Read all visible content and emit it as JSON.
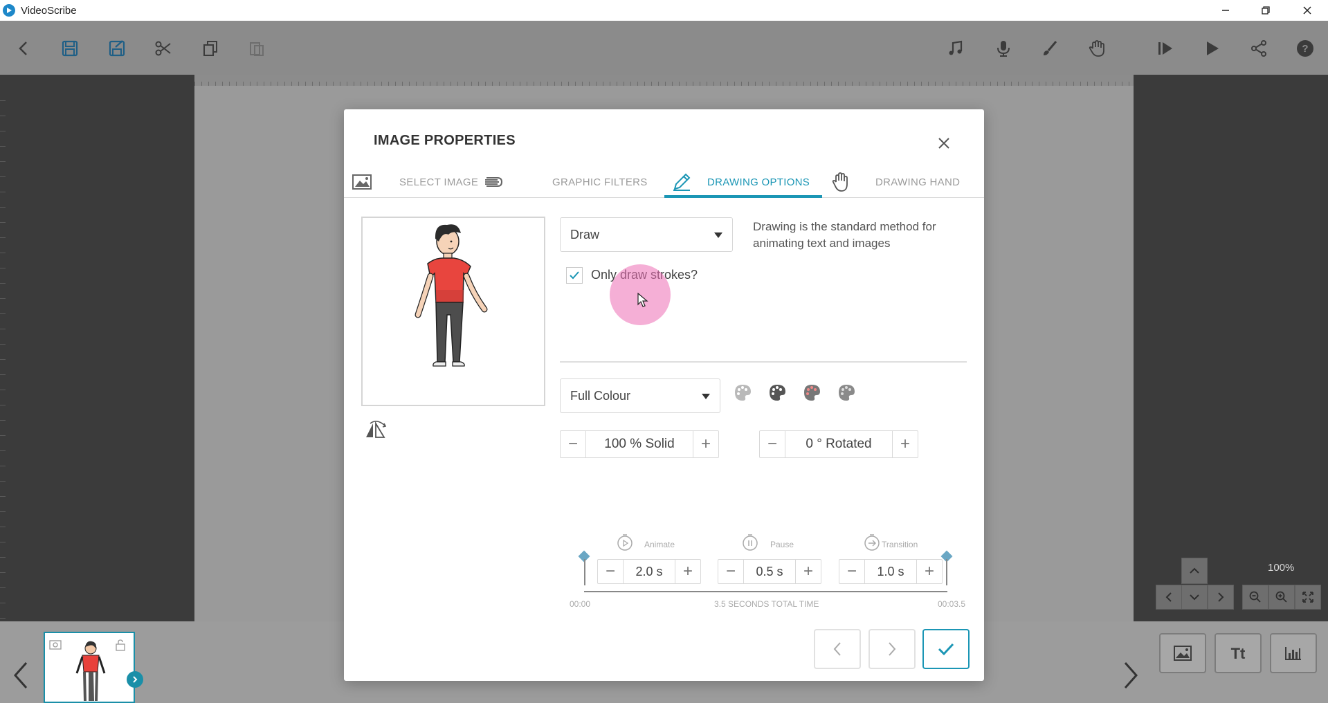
{
  "window": {
    "title": "VideoScribe"
  },
  "toolbar": {
    "left_icons": [
      "back-icon",
      "save-icon",
      "save-as-icon",
      "cut-icon",
      "copy-icon",
      "paste-icon"
    ],
    "right_icons": [
      "music-icon",
      "microphone-icon",
      "brush-icon",
      "hand-icon",
      "preview-from-icon",
      "play-icon",
      "share-icon",
      "help-icon"
    ]
  },
  "canvas": {
    "zoom_label": "100%"
  },
  "modal": {
    "title": "IMAGE PROPERTIES",
    "tabs": [
      {
        "label": "SELECT IMAGE",
        "icon": "image-icon",
        "active": false
      },
      {
        "label": "GRAPHIC FILTERS",
        "icon": "filters-icon",
        "active": false
      },
      {
        "label": "DRAWING OPTIONS",
        "icon": "pencil-icon",
        "active": true
      },
      {
        "label": "DRAWING HAND",
        "icon": "hand-icon",
        "active": false
      }
    ],
    "draw_mode": {
      "selected": "Draw"
    },
    "description": "Drawing is the standard method for animating text and images",
    "only_strokes": {
      "label": "Only draw strokes?",
      "checked": true
    },
    "colour_mode": {
      "selected": "Full Colour"
    },
    "opacity": {
      "value": "100 % Solid"
    },
    "rotation": {
      "value": "0 ° Rotated"
    },
    "timing": {
      "animate": {
        "label": "Animate",
        "value": "2.0 s"
      },
      "pause": {
        "label": "Pause",
        "value": "0.5 s"
      },
      "transition": {
        "label": "Transition",
        "value": "1.0 s"
      },
      "start": "00:00",
      "total": "3.5 SECONDS TOTAL TIME",
      "end": "00:03.5"
    }
  },
  "colors": {
    "accent": "#1b96b5",
    "highlight": "#ec6eb4"
  }
}
